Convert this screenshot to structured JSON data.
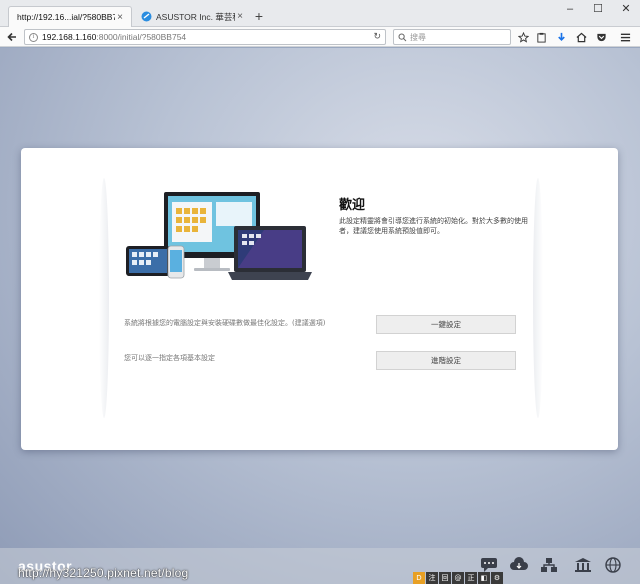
{
  "browser": {
    "tabs": [
      {
        "label": "http://192.16...ial/?580BB754",
        "active": true
      },
      {
        "label": "ASUSTOR Inc. 華芸科技 -...",
        "active": false
      }
    ],
    "url_host": "192.168.1.160",
    "url_rest": ":8000/initial/?580BB754",
    "search_placeholder": "搜尋",
    "window_controls": {
      "minimize": "–",
      "maximize": "☐",
      "close": "✕"
    },
    "new_tab": "+",
    "tab_close": "×"
  },
  "card": {
    "title": "歡迎",
    "description": "此設定精靈將會引導您進行系統的初始化。對於大多數的使用者，建議您使用系統預設值即可。",
    "options": [
      {
        "text": "系統將根據您的電腦設定與安裝硬碟數做最佳化設定。(建議選項)",
        "button": "一鍵設定"
      },
      {
        "text": "您可以逐一指定各項基本設定",
        "button": "進階設定"
      }
    ]
  },
  "footer": {
    "brand": "asustor",
    "watermark": "http://hy321250.pixnet.net/blog",
    "taskbar_labels": [
      "D",
      "注",
      "回",
      "@",
      "正",
      "◧",
      "⚙"
    ]
  },
  "colors": {
    "accent_download": "#1a73e8",
    "taskbar_highlight": "#e8a024"
  }
}
